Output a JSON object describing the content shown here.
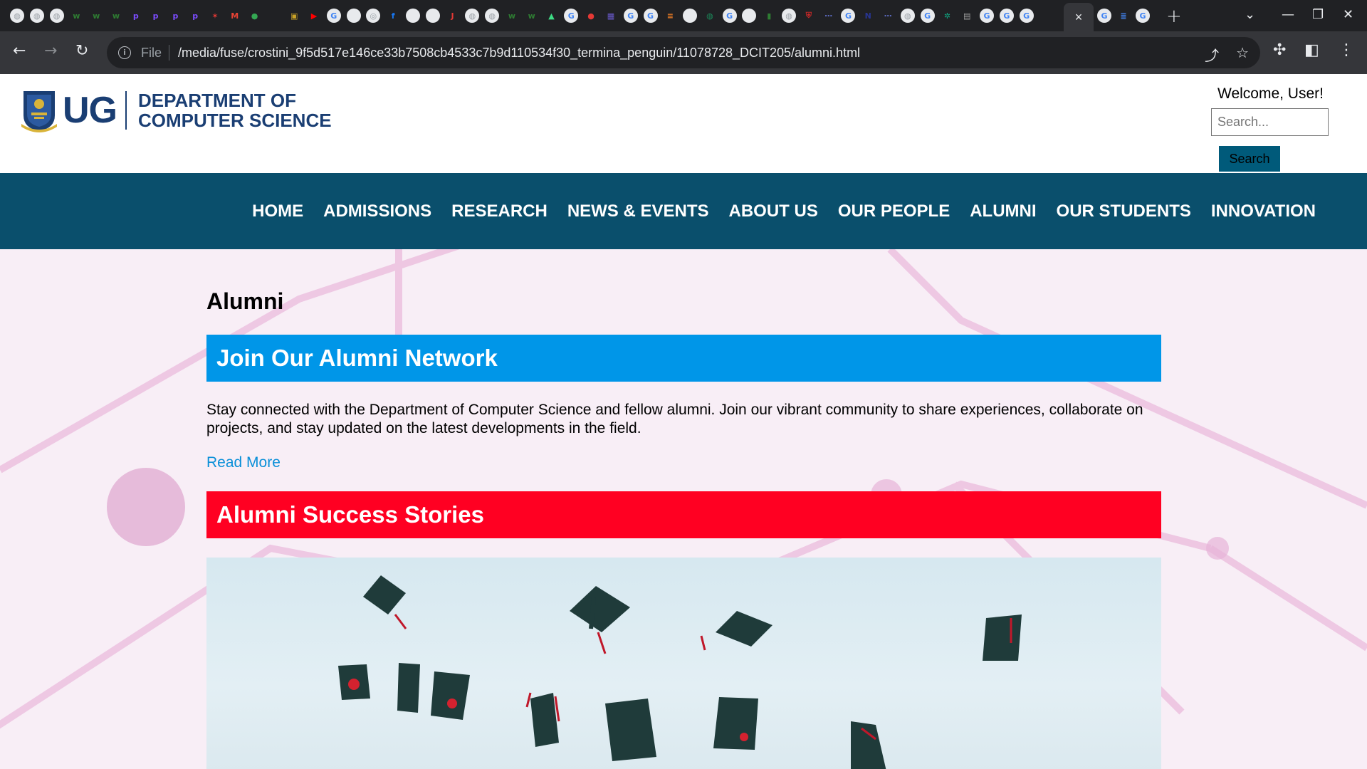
{
  "browser": {
    "active_tab_close": "×",
    "new_tab": "+",
    "file_label": "File",
    "url": "/media/fuse/crostini_9f5d517e146ce33b7508cb4533c7b9d110534f30_termina_penguin/11078728_DCIT205/alumni.html",
    "tab_favicons": [
      "globe",
      "globe",
      "globe",
      "w",
      "w",
      "w",
      "p",
      "p",
      "p",
      "p",
      "figure",
      "gmail",
      "chat",
      "blank",
      "cube",
      "youtube",
      "google",
      "github",
      "podcast",
      "facebook",
      "github",
      "github",
      "jpg",
      "globe",
      "globe",
      "w",
      "w",
      "android",
      "google",
      "record",
      "grid",
      "google",
      "google",
      "stack",
      "github",
      "circle",
      "google",
      "github",
      "chart",
      "globe",
      "shield",
      "dots",
      "google",
      "ntu",
      "dots",
      "globe",
      "google",
      "chatgpt",
      "doc",
      "google",
      "google",
      "google"
    ],
    "tab_favicons_right": [
      "google",
      "docs",
      "google"
    ],
    "colors": {
      "tabstrip": "#202124",
      "toolbar": "#35363a",
      "omnibox": "#202124"
    }
  },
  "header": {
    "logo_abbr": "UG",
    "logo_line1": "DEPARTMENT OF",
    "logo_line2": "COMPUTER SCIENCE",
    "welcome": "Welcome, User!",
    "search_placeholder": "Search...",
    "search_button": "Search"
  },
  "nav": {
    "items": [
      "HOME",
      "ADMISSIONS",
      "RESEARCH",
      "NEWS & EVENTS",
      "ABOUT US",
      "OUR PEOPLE",
      "ALUMNI",
      "OUR STUDENTS",
      "INNOVATION"
    ],
    "color": "#0a4f6c"
  },
  "main": {
    "title": "Alumni",
    "section1": {
      "heading": "Join Our Alumni Network",
      "color": "#0096e8",
      "text": "Stay connected with the Department of Computer Science and fellow alumni. Join our vibrant community to share experiences, collaborate on projects, and stay updated on the latest developments in the field.",
      "link": "Read More"
    },
    "section2": {
      "heading": "Alumni Success Stories",
      "color": "#ff0022"
    },
    "image_subject": "graduation caps thrown in the air"
  }
}
